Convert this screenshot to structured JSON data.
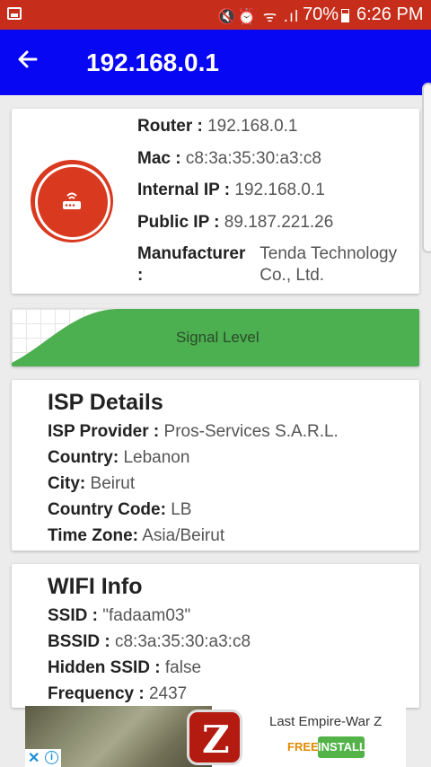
{
  "status_bar": {
    "icons": "🔇⏰ ᯤ .ıl",
    "battery": "70%",
    "time": "6:26 PM",
    "color": "#c62d1b"
  },
  "app_bar": {
    "back_icon": "arrow-left",
    "title": "192.168.0.1",
    "color": "#0707f4"
  },
  "router": {
    "icon": "router-icon",
    "accent": "#d93a1f",
    "lines": [
      {
        "key": "Router :",
        "value": "192.168.0.1"
      },
      {
        "key": "Mac :",
        "value": "c8:3a:35:30:a3:c8"
      },
      {
        "key": "Internal IP :",
        "value": "192.168.0.1"
      },
      {
        "key": "Public IP :",
        "value": "89.187.221.26"
      },
      {
        "key": "Manufacturer :",
        "value": "Tenda Technology Co., Ltd."
      }
    ]
  },
  "signal": {
    "label": "Signal Level",
    "color": "#4caf50"
  },
  "isp": {
    "title": "ISP Details",
    "rows": [
      {
        "key": "ISP Provider :",
        "value": "Pros-Services S.A.R.L."
      },
      {
        "key": "Country:",
        "value": "Lebanon"
      },
      {
        "key": "City:",
        "value": "Beirut"
      },
      {
        "key": "Country Code:",
        "value": "LB"
      },
      {
        "key": "Time Zone:",
        "value": "Asia/Beirut"
      }
    ]
  },
  "wifi": {
    "title": "WIFI Info",
    "rows": [
      {
        "key": "SSID :",
        "value": "\"fadaam03\""
      },
      {
        "key": "BSSID :",
        "value": "c8:3a:35:30:a3:c8"
      },
      {
        "key": "Hidden SSID :",
        "value": "false"
      },
      {
        "key": "Frequency :",
        "value": "2437"
      }
    ]
  },
  "ad": {
    "title": "Last Empire-War Z",
    "free": "FREE",
    "install": "INSTALL",
    "close": "✕",
    "info": "i",
    "logo_text": "Z"
  }
}
